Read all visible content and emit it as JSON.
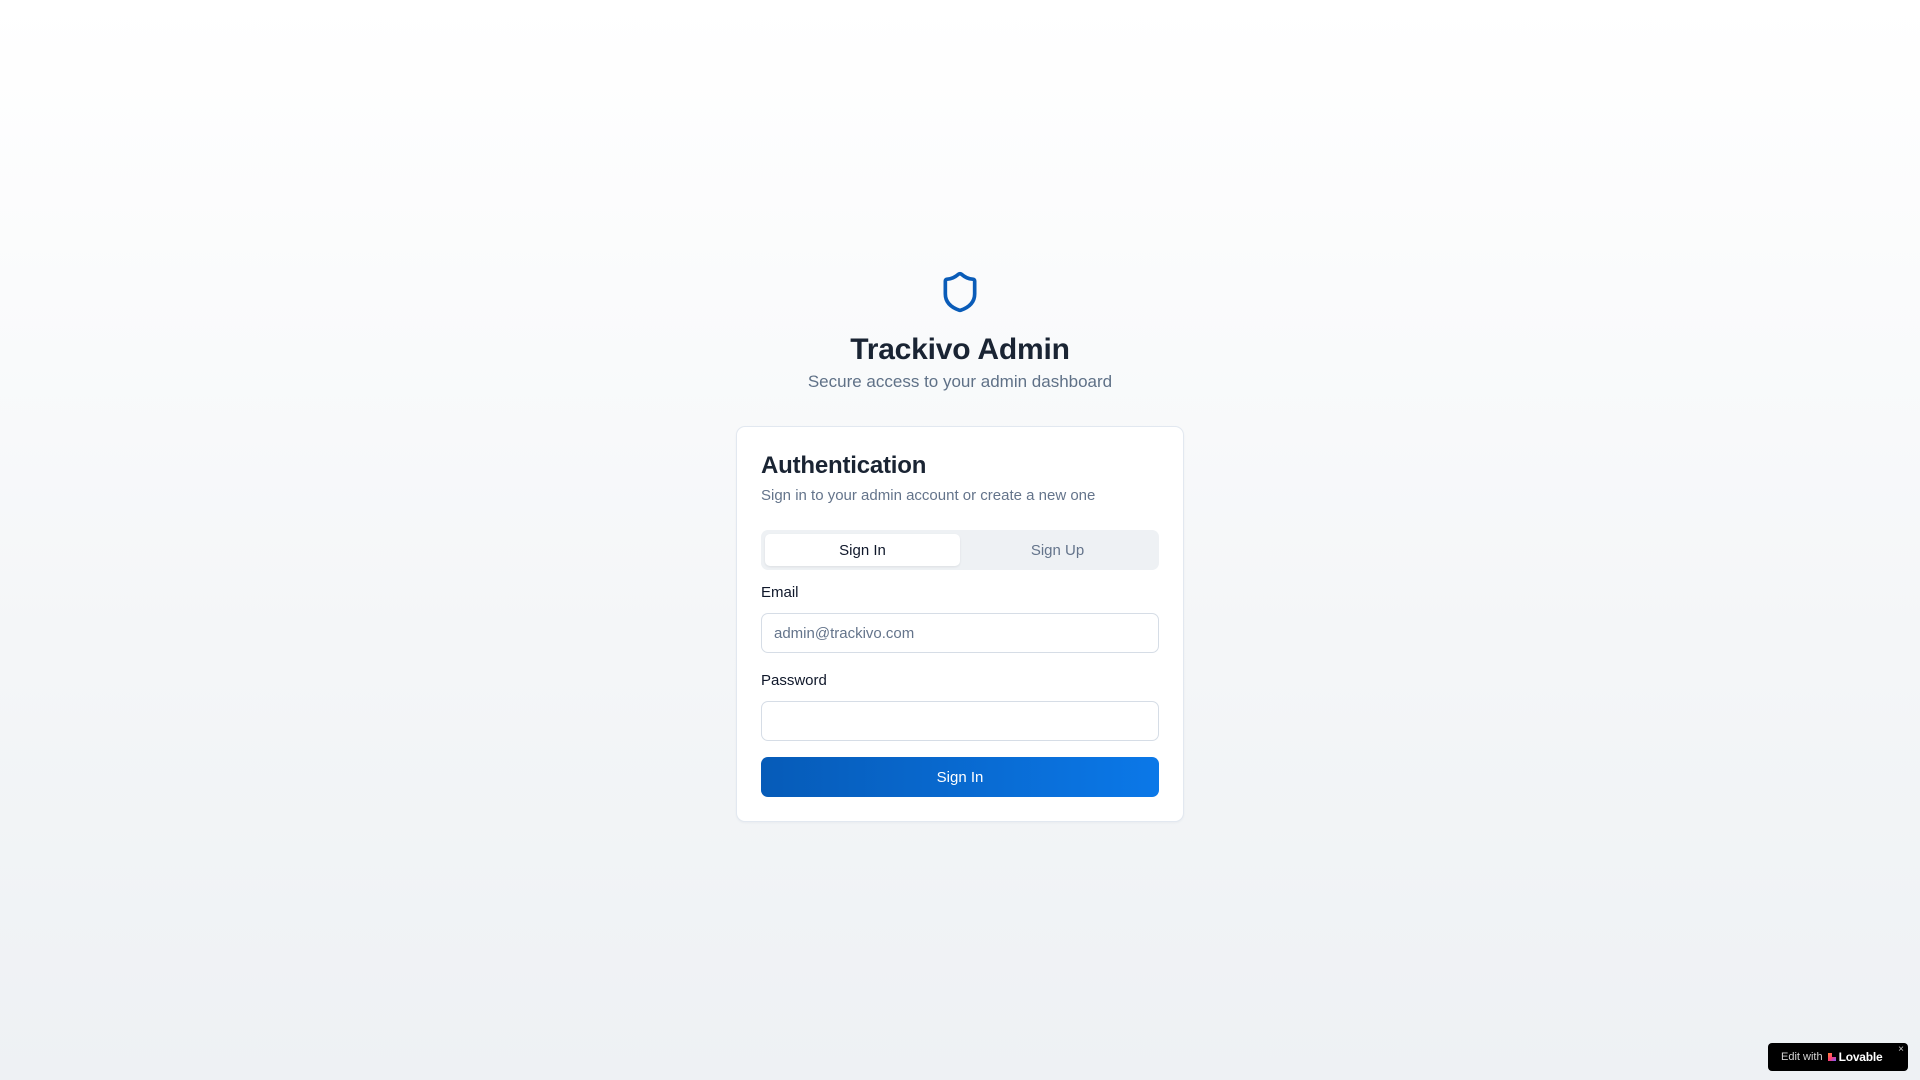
{
  "brand": {
    "title": "Trackivo Admin",
    "subtitle": "Secure access to your admin dashboard",
    "icon": "shield-icon",
    "accent_color": "#0a5cb8"
  },
  "auth_card": {
    "title": "Authentication",
    "description": "Sign in to your admin account or create a new one",
    "tabs": [
      {
        "label": "Sign In",
        "active": true
      },
      {
        "label": "Sign Up",
        "active": false
      }
    ],
    "email": {
      "label": "Email",
      "placeholder": "admin@trackivo.com",
      "value": ""
    },
    "password": {
      "label": "Password",
      "placeholder": "",
      "value": ""
    },
    "submit_label": "Sign In",
    "button_color": "#0b6fd8"
  },
  "badge": {
    "prefix": "Edit with",
    "brand": "Lovable",
    "close": "×",
    "icon": "lovable-heart-icon"
  }
}
